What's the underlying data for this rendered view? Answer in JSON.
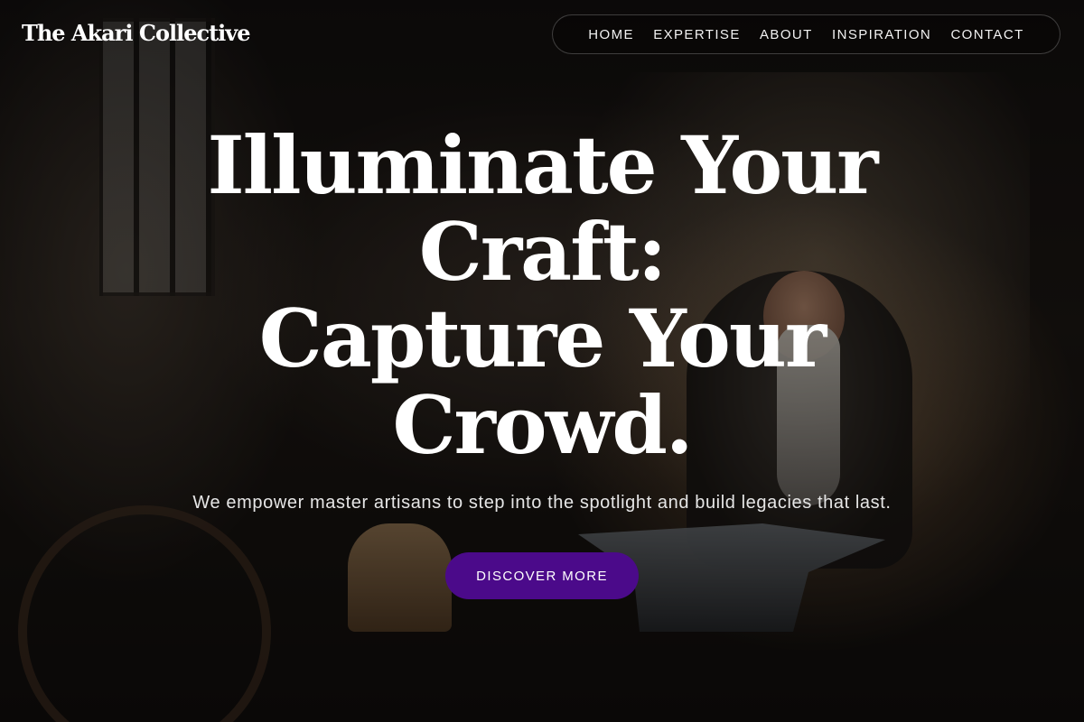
{
  "header": {
    "logo": "The Akari Collective"
  },
  "nav": {
    "items": [
      "HOME",
      "EXPERTISE",
      "ABOUT",
      "INSPIRATION",
      "CONTACT"
    ]
  },
  "hero": {
    "headline_lines": [
      "Illuminate Your",
      "Craft:",
      "Capture Your",
      "Crowd."
    ],
    "subline": "We empower master artisans to step into the spotlight and build legacies that last.",
    "cta_label": "DISCOVER MORE"
  },
  "colors": {
    "cta_background": "#4b0a8a",
    "text": "#ffffff"
  }
}
